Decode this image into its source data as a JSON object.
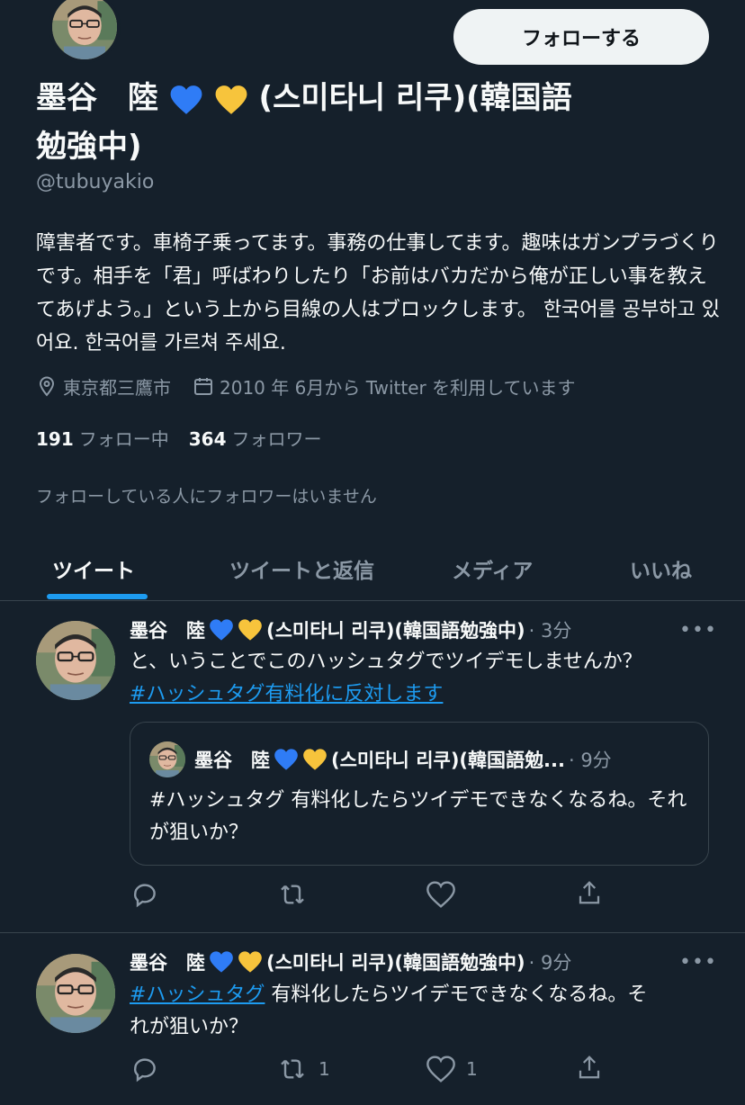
{
  "profile": {
    "follow_label": "フォローする",
    "name_part1": "墨谷　陸",
    "name_part2": "(스미타니 리쿠)(韓国語",
    "name_part3": "勉強中)",
    "handle": "@tubuyakio",
    "bio": "障害者です。車椅子乗ってます。事務の仕事してます。趣味はガンプラづくりです。相手を「君」呼ばわりしたり「お前はバカだから俺が正しい事を教えてあげよう。」という上から目線の人はブロックします。 한국어를 공부하고 있어요. 한국어를 가르쳐 주세요.",
    "location": "東京都三鷹市",
    "joined": "2010 年 6月から Twitter を利用しています",
    "following_count": "191",
    "following_label": "フォロー中",
    "followers_count": "364",
    "followers_label": "フォロワー",
    "no_common_followers": "フォローしている人にフォロワーはいません"
  },
  "tabs": [
    {
      "label": "ツイート"
    },
    {
      "label": "ツイートと返信"
    },
    {
      "label": "メディア"
    },
    {
      "label": "いいね"
    }
  ],
  "tweets": [
    {
      "name_a": "墨谷　陸",
      "name_b": "(스미타니 리쿠)(韓国語勉強中)",
      "time": "· 3分",
      "more": "•••",
      "text_line1": "と、いうことでこのハッシュタグでツイデモしませんか？",
      "hashtag": "#ハッシュタグ有料化に反対します",
      "quote": {
        "name_a": "墨谷　陸",
        "name_b": "(스미타니 리쿠)(韓国語勉...",
        "time": "· 9分",
        "text": "#ハッシュタグ 有料化したらツイデモできなくなるね。それが狙いか？"
      },
      "retweets": "",
      "likes": ""
    },
    {
      "name_a": "墨谷　陸",
      "name_b": "(스미타니 리쿠)(韓国語勉強中)",
      "time": "· 9分",
      "more": "•••",
      "hashtag": "#ハッシュタグ",
      "text_rest": " 有料化したらツイデモできなくなるね。そ",
      "text_line2": "れが狙いか？",
      "retweets": "1",
      "likes": "1"
    }
  ],
  "colors": {
    "background": "#15202b",
    "accent": "#1d9bf0",
    "secondary_text": "#8b98a5",
    "heart_blue": "#2f7cf6",
    "heart_yellow": "#f7c43c"
  },
  "icons": [
    "location-icon",
    "calendar-icon",
    "reply-icon",
    "retweet-icon",
    "like-icon",
    "share-icon",
    "more-icon",
    "blue-heart-icon",
    "yellow-heart-icon"
  ]
}
